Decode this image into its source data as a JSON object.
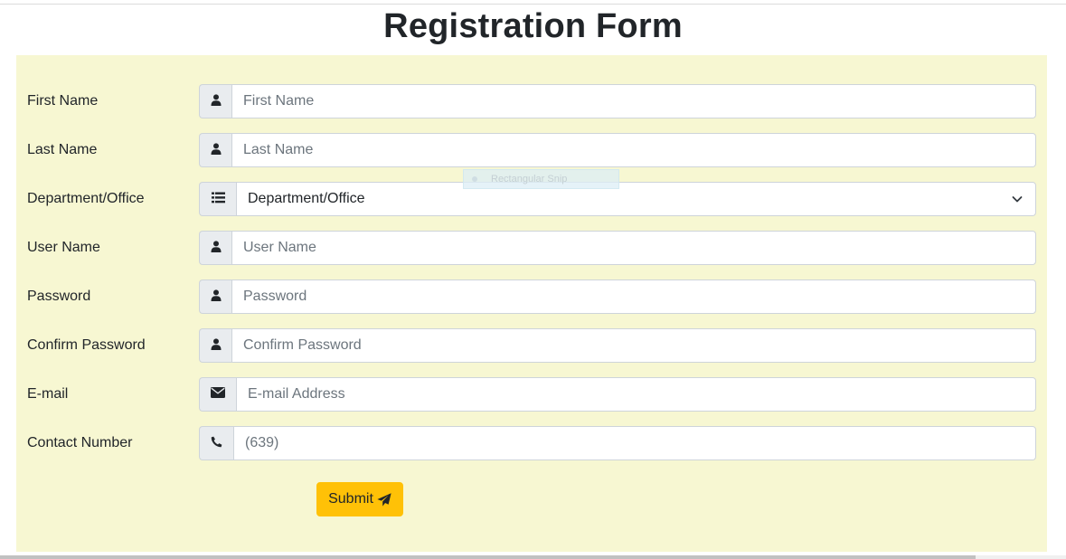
{
  "page": {
    "title": "Registration Form"
  },
  "form": {
    "fields": [
      {
        "label": "First Name",
        "placeholder": "First Name",
        "icon": "user-icon"
      },
      {
        "label": "Last Name",
        "placeholder": "Last Name",
        "icon": "user-icon"
      },
      {
        "label": "Department/Office",
        "selected": "Department/Office",
        "icon": "list-icon"
      },
      {
        "label": "User Name",
        "placeholder": "User Name",
        "icon": "user-icon"
      },
      {
        "label": "Password",
        "placeholder": "Password",
        "icon": "user-icon"
      },
      {
        "label": "Confirm Password",
        "placeholder": "Confirm Password",
        "icon": "user-icon"
      },
      {
        "label": "E-mail",
        "placeholder": "E-mail Address",
        "icon": "envelope-icon"
      },
      {
        "label": "Contact Number",
        "placeholder": "(639)",
        "icon": "phone-icon"
      }
    ],
    "submit_label": "Submit"
  },
  "overlay": {
    "snip_text": "Rectangular Snip"
  },
  "colors": {
    "panel_bg": "#f7f7d2",
    "addon_bg": "#e9ecef",
    "button": "#ffc107",
    "text": "#212529"
  }
}
